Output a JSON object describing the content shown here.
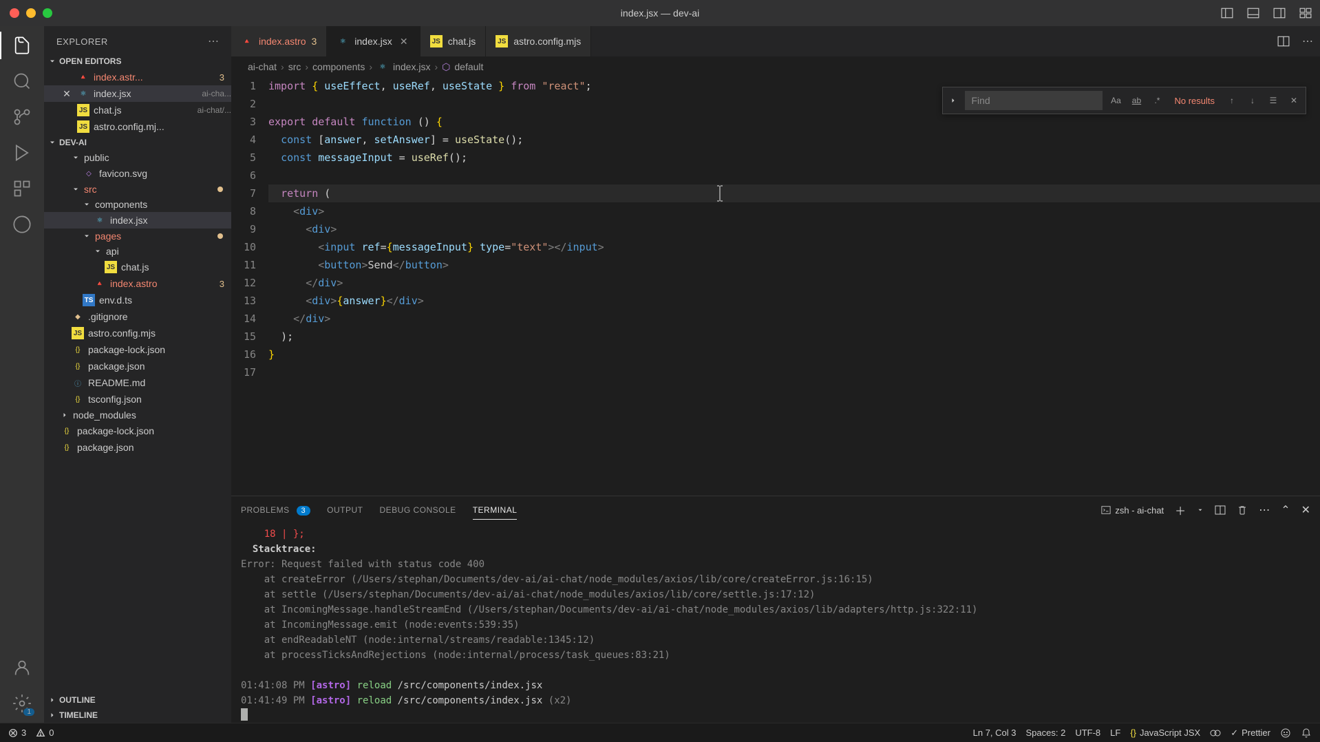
{
  "titlebar": {
    "title": "index.jsx — dev-ai"
  },
  "sidebar": {
    "title": "EXPLORER",
    "sections": {
      "openEditors": "OPEN EDITORS",
      "project": "DEV-AI",
      "outline": "OUTLINE",
      "timeline": "TIMELINE"
    },
    "openEditors": [
      {
        "name": "index.astr...",
        "badge": "3",
        "error": true,
        "icon": "astro"
      },
      {
        "name": "index.jsx",
        "desc": "ai-cha...",
        "active": true,
        "icon": "react"
      },
      {
        "name": "chat.js",
        "desc": "ai-chat/...",
        "icon": "js"
      },
      {
        "name": "astro.config.mj...",
        "icon": "js"
      }
    ],
    "tree": {
      "public": {
        "label": "public"
      },
      "favicon": {
        "label": "favicon.svg"
      },
      "src": {
        "label": "src"
      },
      "components": {
        "label": "components"
      },
      "indexjsx": {
        "label": "index.jsx"
      },
      "pages": {
        "label": "pages"
      },
      "api": {
        "label": "api"
      },
      "chatjs": {
        "label": "chat.js"
      },
      "indexastro": {
        "label": "index.astro",
        "badge": "3"
      },
      "envdts": {
        "label": "env.d.ts"
      },
      "gitignore": {
        "label": ".gitignore"
      },
      "astroconfig": {
        "label": "astro.config.mjs"
      },
      "pkglock": {
        "label": "package-lock.json"
      },
      "pkg": {
        "label": "package.json"
      },
      "readme": {
        "label": "README.md"
      },
      "tsconfig": {
        "label": "tsconfig.json"
      },
      "nodemodules": {
        "label": "node_modules"
      },
      "pkglock2": {
        "label": "package-lock.json"
      },
      "pkg2": {
        "label": "package.json"
      }
    }
  },
  "tabs": [
    {
      "label": "index.astro",
      "icon": "astro",
      "badge": "3",
      "error": true
    },
    {
      "label": "index.jsx",
      "icon": "react",
      "active": true,
      "close": true
    },
    {
      "label": "chat.js",
      "icon": "js"
    },
    {
      "label": "astro.config.mjs",
      "icon": "js"
    }
  ],
  "breadcrumbs": [
    "ai-chat",
    "src",
    "components",
    "index.jsx",
    "default"
  ],
  "find": {
    "placeholder": "Find",
    "results": "No results",
    "caseLabel": "Aa",
    "wordLabel": "ab",
    "regexLabel": ".*"
  },
  "code": {
    "lines": [
      {
        "n": 1,
        "html": "<span class='tok-keyword'>import</span> <span class='tok-brace'>{</span> <span class='tok-var'>useEffect</span><span class='tok-punct'>,</span> <span class='tok-var'>useRef</span><span class='tok-punct'>,</span> <span class='tok-var'>useState</span> <span class='tok-brace'>}</span> <span class='tok-keyword'>from</span> <span class='tok-string'>\"react\"</span><span class='tok-punct'>;</span>"
      },
      {
        "n": 2,
        "html": ""
      },
      {
        "n": 3,
        "html": "<span class='tok-keyword'>export</span> <span class='tok-keyword'>default</span> <span class='tok-type'>function</span> <span class='tok-punct'>()</span> <span class='tok-brace'>{</span>"
      },
      {
        "n": 4,
        "html": "  <span class='tok-type'>const</span> <span class='tok-punct'>[</span><span class='tok-var'>answer</span><span class='tok-punct'>,</span> <span class='tok-var'>setAnswer</span><span class='tok-punct'>]</span> <span class='tok-punct'>=</span> <span class='tok-func'>useState</span><span class='tok-punct'>();</span>"
      },
      {
        "n": 5,
        "html": "  <span class='tok-type'>const</span> <span class='tok-var'>messageInput</span> <span class='tok-punct'>=</span> <span class='tok-func'>useRef</span><span class='tok-punct'>();</span>"
      },
      {
        "n": 6,
        "html": ""
      },
      {
        "n": 7,
        "html": "  <span class='tok-keyword'>return</span> <span class='tok-punct'>(</span>",
        "current": true
      },
      {
        "n": 8,
        "html": "    <span class='tok-jsx'>&lt;</span><span class='tok-tag'>div</span><span class='tok-jsx'>&gt;</span>"
      },
      {
        "n": 9,
        "html": "      <span class='tok-jsx'>&lt;</span><span class='tok-tag'>div</span><span class='tok-jsx'>&gt;</span>"
      },
      {
        "n": 10,
        "html": "        <span class='tok-jsx'>&lt;</span><span class='tok-tag'>input</span> <span class='tok-attr'>ref</span><span class='tok-punct'>=</span><span class='tok-brace'>{</span><span class='tok-var'>messageInput</span><span class='tok-brace'>}</span> <span class='tok-attr'>type</span><span class='tok-punct'>=</span><span class='tok-string'>\"text\"</span><span class='tok-jsx'>&gt;&lt;/</span><span class='tok-tag'>input</span><span class='tok-jsx'>&gt;</span>"
      },
      {
        "n": 11,
        "html": "        <span class='tok-jsx'>&lt;</span><span class='tok-tag'>button</span><span class='tok-jsx'>&gt;</span>Send<span class='tok-jsx'>&lt;/</span><span class='tok-tag'>button</span><span class='tok-jsx'>&gt;</span>"
      },
      {
        "n": 12,
        "html": "      <span class='tok-jsx'>&lt;/</span><span class='tok-tag'>div</span><span class='tok-jsx'>&gt;</span>"
      },
      {
        "n": 13,
        "html": "      <span class='tok-jsx'>&lt;</span><span class='tok-tag'>div</span><span class='tok-jsx'>&gt;</span><span class='tok-brace'>{</span><span class='tok-var'>answer</span><span class='tok-brace'>}</span><span class='tok-jsx'>&lt;/</span><span class='tok-tag'>div</span><span class='tok-jsx'>&gt;</span>"
      },
      {
        "n": 14,
        "html": "    <span class='tok-jsx'>&lt;/</span><span class='tok-tag'>div</span><span class='tok-jsx'>&gt;</span>"
      },
      {
        "n": 15,
        "html": "  <span class='tok-punct'>);</span>"
      },
      {
        "n": 16,
        "html": "<span class='tok-brace'>}</span>"
      },
      {
        "n": 17,
        "html": ""
      }
    ]
  },
  "panel": {
    "tabs": {
      "problems": "PROBLEMS",
      "problemsBadge": "3",
      "output": "OUTPUT",
      "debug": "DEBUG CONSOLE",
      "terminal": "TERMINAL"
    },
    "termLabel": "zsh - ai-chat",
    "lines": [
      {
        "html": "    <span class='term-red'>18 | };</span>"
      },
      {
        "html": "  <span class='term-bold'>Stacktrace:</span>"
      },
      {
        "html": "<span class='term-dim'>Error: Request failed with status code 400</span>"
      },
      {
        "html": "<span class='term-dim'>    at createError (/Users/stephan/Documents/dev-ai/ai-chat/node_modules/axios/lib/core/createError.js:16:15)</span>"
      },
      {
        "html": "<span class='term-dim'>    at settle (/Users/stephan/Documents/dev-ai/ai-chat/node_modules/axios/lib/core/settle.js:17:12)</span>"
      },
      {
        "html": "<span class='term-dim'>    at IncomingMessage.handleStreamEnd (/Users/stephan/Documents/dev-ai/ai-chat/node_modules/axios/lib/adapters/http.js:322:11)</span>"
      },
      {
        "html": "<span class='term-dim'>    at IncomingMessage.emit (node:events:539:35)</span>"
      },
      {
        "html": "<span class='term-dim'>    at endReadableNT (node:internal/streams/readable:1345:12)</span>"
      },
      {
        "html": "<span class='term-dim'>    at processTicksAndRejections (node:internal/process/task_queues:83:21)</span>"
      },
      {
        "html": ""
      },
      {
        "html": "<span class='term-dim'>01:41:08 PM</span> <span class='term-purple'>[astro]</span> <span class='term-green'>reload</span> /src/components/index.jsx"
      },
      {
        "html": "<span class='term-dim'>01:41:49 PM</span> <span class='term-purple'>[astro]</span> <span class='term-green'>reload</span> /src/components/index.jsx <span class='term-dim'>(x2)</span>"
      },
      {
        "html": "<span class='term-cursor'></span>"
      }
    ]
  },
  "status": {
    "errors": "3",
    "warnings": "0",
    "position": "Ln 7, Col 3",
    "spaces": "Spaces: 2",
    "encoding": "UTF-8",
    "eol": "LF",
    "lang": "JavaScript JSX",
    "prettier": "Prettier"
  },
  "activityBadge": "1"
}
